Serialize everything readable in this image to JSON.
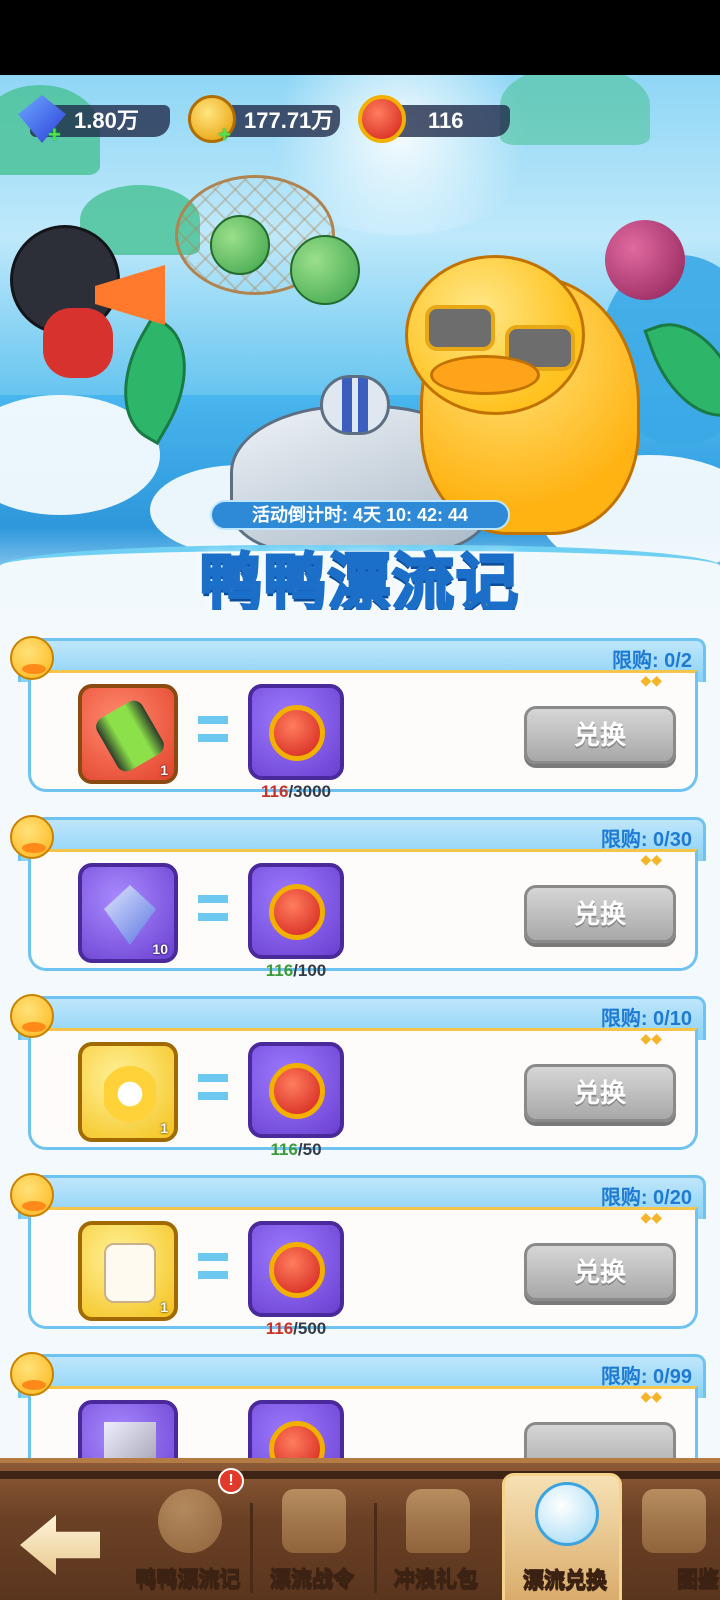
{
  "resources": {
    "diamond": "1.80万",
    "gold": "177.71万",
    "apple": "116"
  },
  "event": {
    "countdown": "活动倒计时: 4天 10: 42: 44",
    "title": "鸭鸭漂流记"
  },
  "exchange_items": [
    {
      "limit": "限购: 0/2",
      "item_qty": "1",
      "item_icon": "battery-icon",
      "have": "116",
      "need": "/3000",
      "enough": false,
      "button": "兑换"
    },
    {
      "limit": "限购: 0/30",
      "item_qty": "10",
      "item_icon": "diamond-icon",
      "have": "116",
      "need": "/100",
      "enough": true,
      "button": "兑换"
    },
    {
      "limit": "限购: 0/10",
      "item_qty": "1",
      "item_icon": "flower-icon",
      "have": "116",
      "need": "/50",
      "enough": true,
      "button": "兑换"
    },
    {
      "limit": "限购: 0/20",
      "item_qty": "1",
      "item_icon": "dice-icon",
      "have": "116",
      "need": "/500",
      "enough": false,
      "button": "兑换"
    },
    {
      "limit": "限购: 0/99",
      "item_qty": "",
      "item_icon": "crystal-icon",
      "have": "",
      "need": "",
      "enough": false,
      "button": ""
    }
  ],
  "bottom_nav": {
    "tabs": [
      {
        "label": "鸭鸭漂流记",
        "icon": "duck-icon",
        "badge": "!"
      },
      {
        "label": "漂流战令",
        "icon": "scroll-icon"
      },
      {
        "label": "冲浪礼包",
        "icon": "shop-icon"
      },
      {
        "label": "漂流兑换",
        "icon": "exchange-icon",
        "active": true
      },
      {
        "label": "图鉴",
        "icon": "book-icon"
      }
    ]
  },
  "colors": {
    "accent_blue": "#1f7bd1",
    "insufficient": "#c9312b",
    "sufficient": "#3d9a3a",
    "title_yellow": "#ffd43a"
  }
}
